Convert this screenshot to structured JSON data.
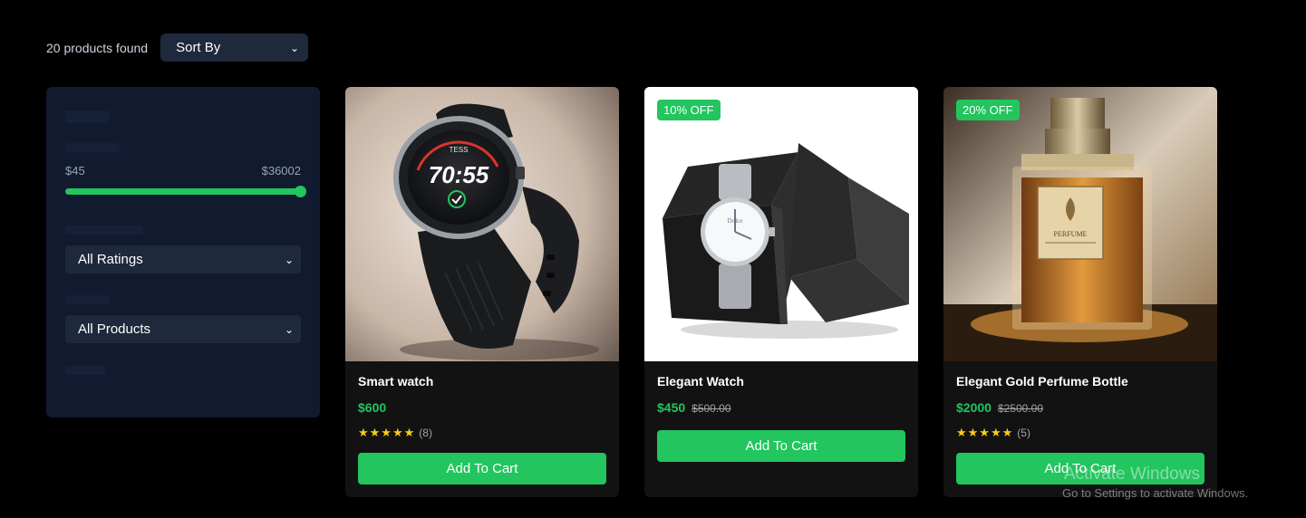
{
  "toolbar": {
    "count_text": "20 products found",
    "sort_label": "Sort By"
  },
  "filters": {
    "price_min": "$45",
    "price_max": "$36002",
    "slider_fraction": 1.0,
    "rating_select": "All Ratings",
    "product_select": "All Products"
  },
  "products": [
    {
      "title": "Smart watch",
      "price": "$600",
      "old_price": "",
      "badge": "",
      "stars": "★★★★★",
      "reviews": "(8)",
      "button": "Add To Cart"
    },
    {
      "title": "Elegant Watch",
      "price": "$450",
      "old_price": "$500.00",
      "badge": "10% OFF",
      "stars": "",
      "reviews": "",
      "button": "Add To Cart"
    },
    {
      "title": "Elegant Gold Perfume Bottle",
      "price": "$2000",
      "old_price": "$2500.00",
      "badge": "20% OFF",
      "stars": "★★★★★",
      "reviews": "(5)",
      "button": "Add To Cart"
    }
  ],
  "watermark": {
    "line1": "Activate Windows",
    "line2": "Go to Settings to activate Windows."
  },
  "colors": {
    "accent": "#22c55e",
    "panel": "#111a2e",
    "select": "#1e293b",
    "card": "#121212",
    "star": "#facc15"
  },
  "icons": {
    "dropdown": "chevron-down-icon",
    "star": "star-icon"
  }
}
